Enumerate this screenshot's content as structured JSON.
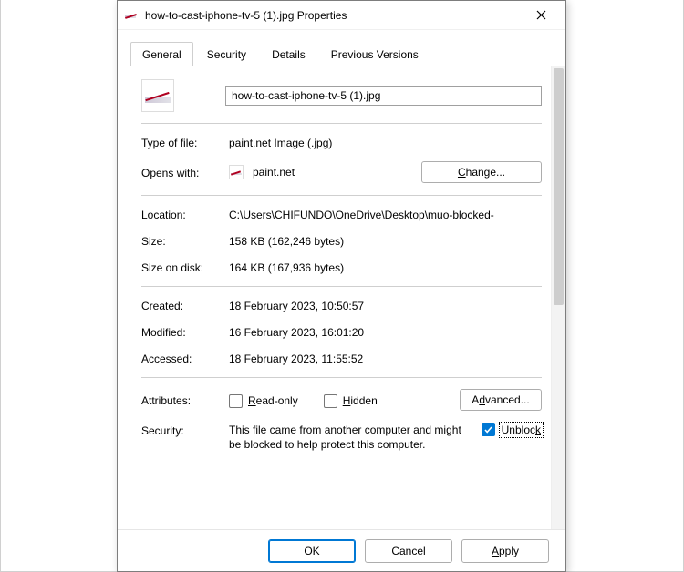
{
  "window": {
    "title": "how-to-cast-iphone-tv-5 (1).jpg Properties"
  },
  "tabs": {
    "items": [
      "General",
      "Security",
      "Details",
      "Previous Versions"
    ],
    "active": 0
  },
  "file": {
    "name": "how-to-cast-iphone-tv-5 (1).jpg"
  },
  "labels": {
    "type_of_file": "Type of file:",
    "opens_with": "Opens with:",
    "change_btn": "Change...",
    "location": "Location:",
    "size": "Size:",
    "size_on_disk": "Size on disk:",
    "created": "Created:",
    "modified": "Modified:",
    "accessed": "Accessed:",
    "attributes": "Attributes:",
    "read_only": "Read-only",
    "hidden": "Hidden",
    "advanced_btn": "Advanced...",
    "security": "Security:",
    "unblock": "Unblock"
  },
  "values": {
    "type_of_file": "paint.net Image (.jpg)",
    "opens_with": "paint.net",
    "location": "C:\\Users\\CHIFUNDO\\OneDrive\\Desktop\\muo-blocked-",
    "size": "158 KB (162,246 bytes)",
    "size_on_disk": "164 KB (167,936 bytes)",
    "created": "18 February 2023, 10:50:57",
    "modified": "16 February 2023, 16:01:20",
    "accessed": "18 February 2023, 11:55:52",
    "security_msg": "This file came from another computer and might be blocked to help protect this computer."
  },
  "state": {
    "read_only": false,
    "hidden": false,
    "unblock": true
  },
  "buttons": {
    "ok": "OK",
    "cancel": "Cancel",
    "apply": "Apply"
  }
}
